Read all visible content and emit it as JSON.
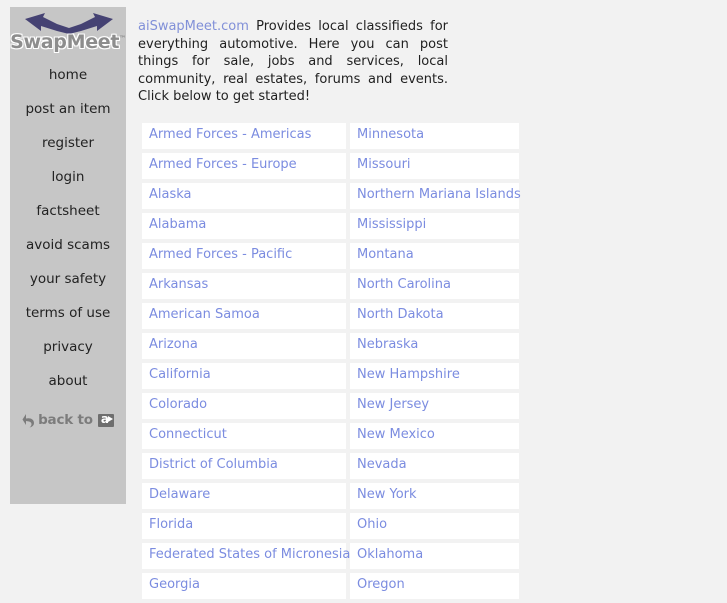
{
  "sidebar": {
    "logo": {
      "wordmark": "SwapMeet",
      "trademark": "™",
      "arrow_icon": "double-arrow-icon",
      "arrow_color": "#454273"
    },
    "nav_items": [
      {
        "label": "home"
      },
      {
        "label": "post an item"
      },
      {
        "label": "register"
      },
      {
        "label": "login"
      },
      {
        "label": "factsheet"
      },
      {
        "label": "avoid scams"
      },
      {
        "label": "your safety"
      },
      {
        "label": "terms of use"
      },
      {
        "label": "privacy"
      },
      {
        "label": "about"
      }
    ],
    "back_link": {
      "label": "back to",
      "arrow_icon": "back-arrow-icon",
      "logo_icon": "ai-mini-logo-icon"
    },
    "background_color": "#c6c6c6"
  },
  "main": {
    "intro": {
      "site_name": "aiSwapMeet.com",
      "body": " Provides local classifieds for everything automotive. Here you can post things for sale, jobs and services, local community, real estates, forums and events. Click below to get started!"
    },
    "locations_table": {
      "rows": [
        {
          "left": "Armed Forces - Americas",
          "right": "Minnesota"
        },
        {
          "left": "Armed Forces - Europe",
          "right": "Missouri"
        },
        {
          "left": "Alaska",
          "right": "Northern Mariana Islands"
        },
        {
          "left": "Alabama",
          "right": "Mississippi"
        },
        {
          "left": "Armed Forces - Pacific",
          "right": "Montana"
        },
        {
          "left": "Arkansas",
          "right": "North Carolina"
        },
        {
          "left": "American Samoa",
          "right": "North Dakota"
        },
        {
          "left": "Arizona",
          "right": "Nebraska"
        },
        {
          "left": "California",
          "right": "New Hampshire"
        },
        {
          "left": "Colorado",
          "right": "New Jersey"
        },
        {
          "left": "Connecticut",
          "right": "New Mexico"
        },
        {
          "left": "District of Columbia",
          "right": "Nevada"
        },
        {
          "left": "Delaware",
          "right": "New York"
        },
        {
          "left": "Florida",
          "right": "Ohio"
        },
        {
          "left": "Federated States of Micronesia",
          "right": "Oklahoma"
        },
        {
          "left": "Georgia",
          "right": "Oregon"
        }
      ]
    }
  },
  "colors": {
    "page_background": "#f2f2f2",
    "link_blue": "#7b8ce0",
    "sidebar_gray": "#c6c6c6",
    "cell_white": "#ffffff",
    "text_dark": "#1f1f1f"
  }
}
